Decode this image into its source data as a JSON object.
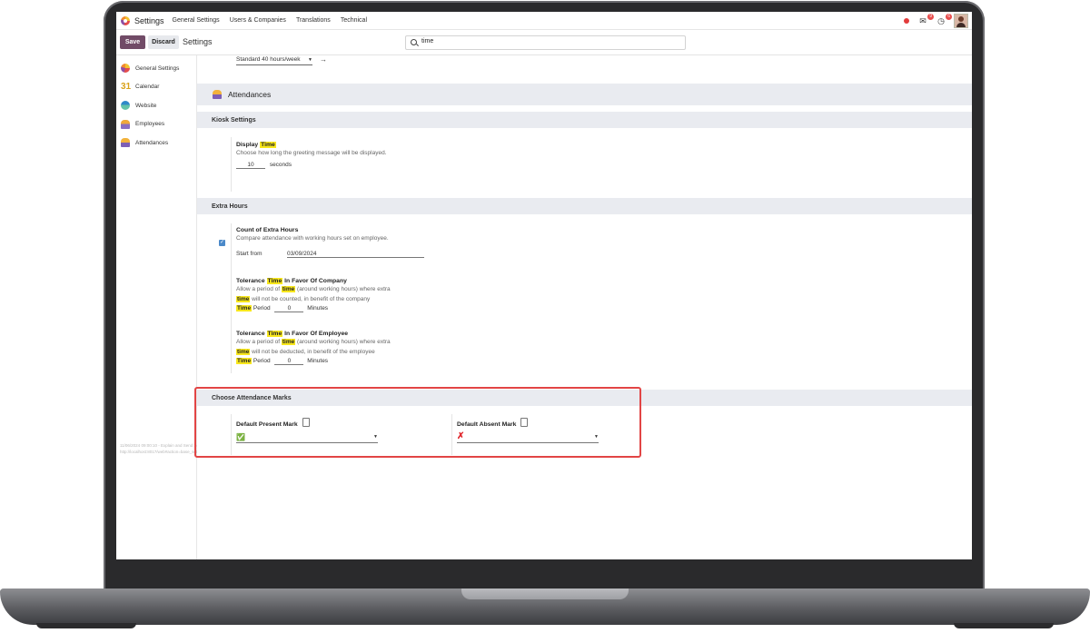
{
  "navbar": {
    "app_name": "Settings",
    "menu": [
      "General Settings",
      "Users & Companies",
      "Translations",
      "Technical"
    ],
    "chat_badge": "9",
    "activity_badge": "6"
  },
  "control": {
    "save_label": "Save",
    "discard_label": "Discard",
    "title": "Settings",
    "search_value": "time"
  },
  "sidebar": {
    "items": [
      {
        "label": "General Settings",
        "icon": "odoo-logo-icon"
      },
      {
        "label": "Calendar",
        "icon": "calendar-icon",
        "glyph": "31"
      },
      {
        "label": "Website",
        "icon": "website-icon"
      },
      {
        "label": "Employees",
        "icon": "employees-icon"
      },
      {
        "label": "Attendances",
        "icon": "attendances-icon"
      }
    ]
  },
  "content": {
    "previous_select_value": "Standard 40 hours/week",
    "app_title": "Attendances",
    "kiosk": {
      "header": "Kiosk Settings",
      "display_title_pre": "Display ",
      "display_title_hl": "Time",
      "display_desc": "Choose how long the greeting message will be displayed.",
      "seconds_value": "10",
      "seconds_unit": "seconds"
    },
    "extra": {
      "header": "Extra Hours",
      "count_title": "Count of Extra Hours",
      "count_desc": "Compare attendance with working hours set on employee.",
      "start_label": "Start from",
      "start_value": "03/09/2024",
      "tol_company": {
        "t1": "Tolerance ",
        "hl": "Time",
        "t2": " In Favor Of Company",
        "d1": "Allow a period of ",
        "d_hl": "time",
        "d2": " (around working hours) where extra",
        "d3_hl": "time",
        "d3": " will not be counted, in benefit of the company",
        "period_hl": "Time",
        "period": " Period",
        "value": "0",
        "unit": "Minutes"
      },
      "tol_employee": {
        "t1": "Tolerance ",
        "hl": "Time",
        "t2": " In Favor Of Employee",
        "d1": "Allow a period of ",
        "d_hl": "time",
        "d2": " (around working hours) where extra",
        "d3_hl": "time",
        "d3": " will not be deducted, in benefit of the employee",
        "period_hl": "Time",
        "period": " Period",
        "value": "0",
        "unit": "Minutes"
      }
    },
    "marks": {
      "header": "Choose Attendance Marks",
      "present_label": "Default Present Mark",
      "present_value": "✅",
      "absent_label": "Default Absent Mark",
      "absent_value": "✗"
    },
    "faint_line1": "11/06/2024 09:00:10 - Explain and Send Screenshots",
    "faint_line2": "http://localhost:8017/web#action=base_setup.action_general_configuration&menu_id=1"
  },
  "colors": {
    "primary": "#714b67",
    "highlight": "#f8e71c",
    "section_bg": "#e9ebf0",
    "annotation_box": "#e24545"
  }
}
